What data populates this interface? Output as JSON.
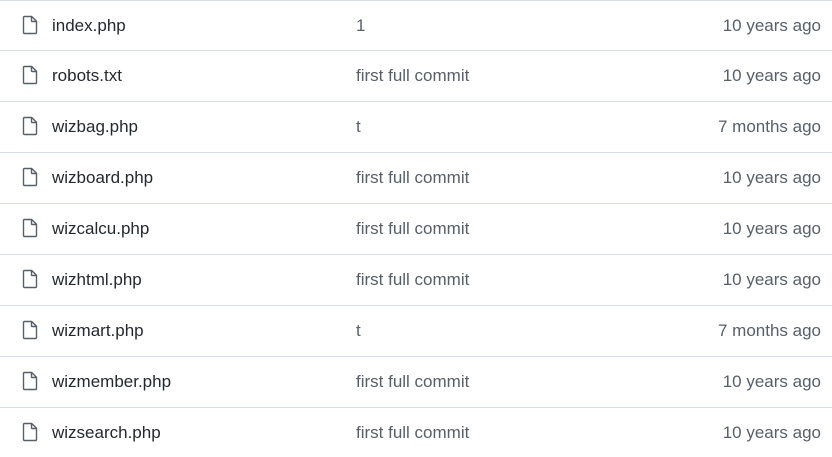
{
  "files": [
    {
      "icon": "file-icon",
      "name": "index.php",
      "message": "1",
      "age": "10 years ago"
    },
    {
      "icon": "file-icon",
      "name": "robots.txt",
      "message": "first full commit",
      "age": "10 years ago"
    },
    {
      "icon": "file-icon",
      "name": "wizbag.php",
      "message": "t",
      "age": "7 months ago"
    },
    {
      "icon": "file-icon",
      "name": "wizboard.php",
      "message": "first full commit",
      "age": "10 years ago"
    },
    {
      "icon": "file-icon",
      "name": "wizcalcu.php",
      "message": "first full commit",
      "age": "10 years ago"
    },
    {
      "icon": "file-icon",
      "name": "wizhtml.php",
      "message": "first full commit",
      "age": "10 years ago"
    },
    {
      "icon": "file-icon",
      "name": "wizmart.php",
      "message": "t",
      "age": "7 months ago"
    },
    {
      "icon": "file-icon",
      "name": "wizmember.php",
      "message": "first full commit",
      "age": "10 years ago"
    },
    {
      "icon": "file-icon",
      "name": "wizsearch.php",
      "message": "first full commit",
      "age": "10 years ago"
    }
  ],
  "colors": {
    "name_text": "#24292f",
    "muted_text": "#57606a",
    "divider": "#d8dee4",
    "icon": "#57606a"
  }
}
